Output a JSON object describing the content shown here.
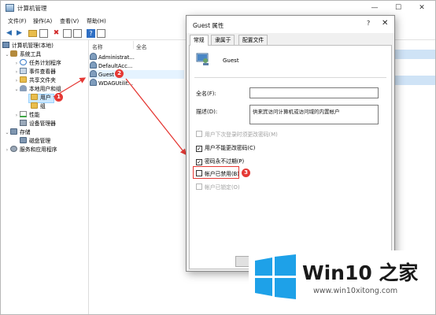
{
  "window": {
    "title": "计算机管理",
    "min": "—",
    "max": "☐",
    "close": "✕"
  },
  "menu": [
    "文件(F)",
    "操作(A)",
    "查看(V)",
    "帮助(H)"
  ],
  "tree": {
    "root": "计算机管理(本地)",
    "system_tools": "系统工具",
    "task_scheduler": "任务计划程序",
    "event_viewer": "事件查看器",
    "shared_folders": "共享文件夹",
    "local_users_groups": "本地用户和组",
    "users": "用户",
    "groups": "组",
    "performance": "性能",
    "device_manager": "设备管理器",
    "storage": "存储",
    "disk_management": "磁盘管理",
    "services_apps": "服务和应用程序"
  },
  "list": {
    "col_name": "名称",
    "col_fullname": "全名",
    "rows": [
      "Administrat...",
      "DefaultAcc...",
      "Guest",
      "WDAGUtilit..."
    ]
  },
  "dialog": {
    "title": "Guest 属性",
    "help": "?",
    "close": "✕",
    "tabs": [
      "常规",
      "隶属于",
      "配置文件"
    ],
    "username": "Guest",
    "fullname_label": "全名(F):",
    "fullname_value": "",
    "desc_label": "描述(D):",
    "desc_value": "供来宾访问计算机或访问域的内置帐户",
    "checkboxes": {
      "must_change": "用户下次登录时须更改密码(M)",
      "cannot_change": "用户不能更改密码(C)",
      "never_expires": "密码永不过期(P)",
      "disabled": "帐户已禁用(B)",
      "locked": "帐户已锁定(O)"
    },
    "ok_button": "确"
  },
  "annotations": [
    "1",
    "2",
    "3"
  ],
  "watermark": {
    "brand": "Win10 之家",
    "url": "www.win10xitong.com"
  },
  "colors": {
    "highlight_red": "#e53935",
    "selection_blue": "#cce8ff",
    "logo_blue": "#1ea1e8"
  }
}
